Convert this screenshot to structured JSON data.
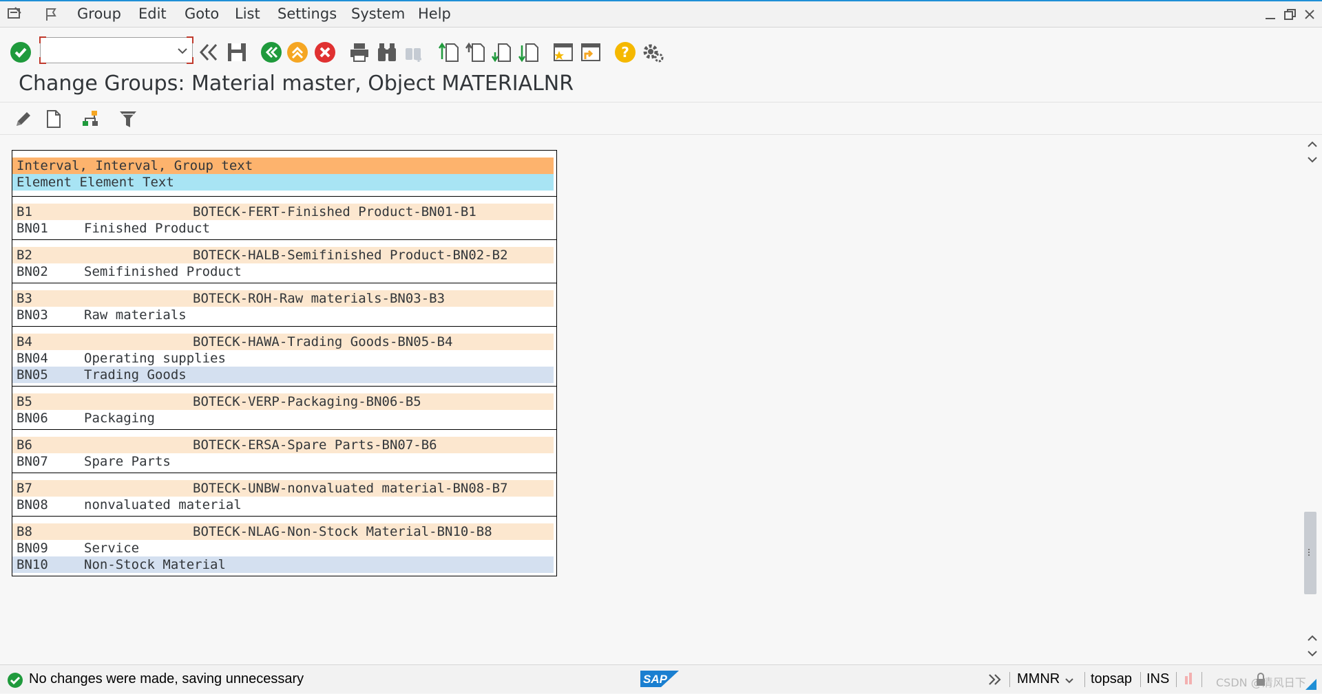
{
  "menu": {
    "items": [
      "Group",
      "Edit",
      "Goto",
      "List",
      "Settings",
      "System",
      "Help"
    ]
  },
  "window": {
    "title": "Change Groups: Material master, Object MATERIALNR"
  },
  "command_field": {
    "value": ""
  },
  "list": {
    "header": {
      "line1": "Interval, Interval, Group text",
      "line2": "Element Element Text"
    },
    "groups": [
      {
        "from": "B1",
        "text": "BOTECK-FERT-Finished Product-BN01-B1",
        "elements": [
          {
            "code": "BN01",
            "text": "Finished Product",
            "selected": false
          }
        ]
      },
      {
        "from": "B2",
        "text": "BOTECK-HALB-Semifinished Product-BN02-B2",
        "elements": [
          {
            "code": "BN02",
            "text": "Semifinished Product",
            "selected": false
          }
        ]
      },
      {
        "from": "B3",
        "text": "BOTECK-ROH-Raw materials-BN03-B3",
        "elements": [
          {
            "code": "BN03",
            "text": "Raw materials",
            "selected": false
          }
        ]
      },
      {
        "from": "B4",
        "text": "BOTECK-HAWA-Trading Goods-BN05-B4",
        "elements": [
          {
            "code": "BN04",
            "text": "Operating supplies",
            "selected": false
          },
          {
            "code": "BN05",
            "text": "Trading Goods",
            "selected": true
          }
        ]
      },
      {
        "from": "B5",
        "text": "BOTECK-VERP-Packaging-BN06-B5",
        "elements": [
          {
            "code": "BN06",
            "text": "Packaging",
            "selected": false
          }
        ]
      },
      {
        "from": "B6",
        "text": "BOTECK-ERSA-Spare Parts-BN07-B6",
        "elements": [
          {
            "code": "BN07",
            "text": "Spare Parts",
            "selected": false
          }
        ]
      },
      {
        "from": "B7",
        "text": "BOTECK-UNBW-nonvaluated material-BN08-B7",
        "elements": [
          {
            "code": "BN08",
            "text": "nonvaluated material",
            "selected": false
          }
        ]
      },
      {
        "from": "B8",
        "text": "BOTECK-NLAG-Non-Stock Material-BN10-B8",
        "elements": [
          {
            "code": "BN09",
            "text": "Service",
            "selected": false
          },
          {
            "code": "BN10",
            "text": "Non-Stock Material",
            "selected": true
          }
        ]
      }
    ]
  },
  "status": {
    "message": "No changes were made, saving unnecessary",
    "logo": "SAP",
    "program": "MMNR",
    "server": "topsap",
    "mode": "INS",
    "watermark": "CSDN @清风日下"
  },
  "colors": {
    "header_orange": "#fdb36d",
    "header_blue": "#a8e4f4",
    "group_row": "#fce7cf",
    "selected_row": "#d4e0f0",
    "ok_green": "#1f9a3c",
    "cancel_red": "#e03131",
    "help_yellow": "#f5b800",
    "sap_blue": "#1a7fd0"
  }
}
